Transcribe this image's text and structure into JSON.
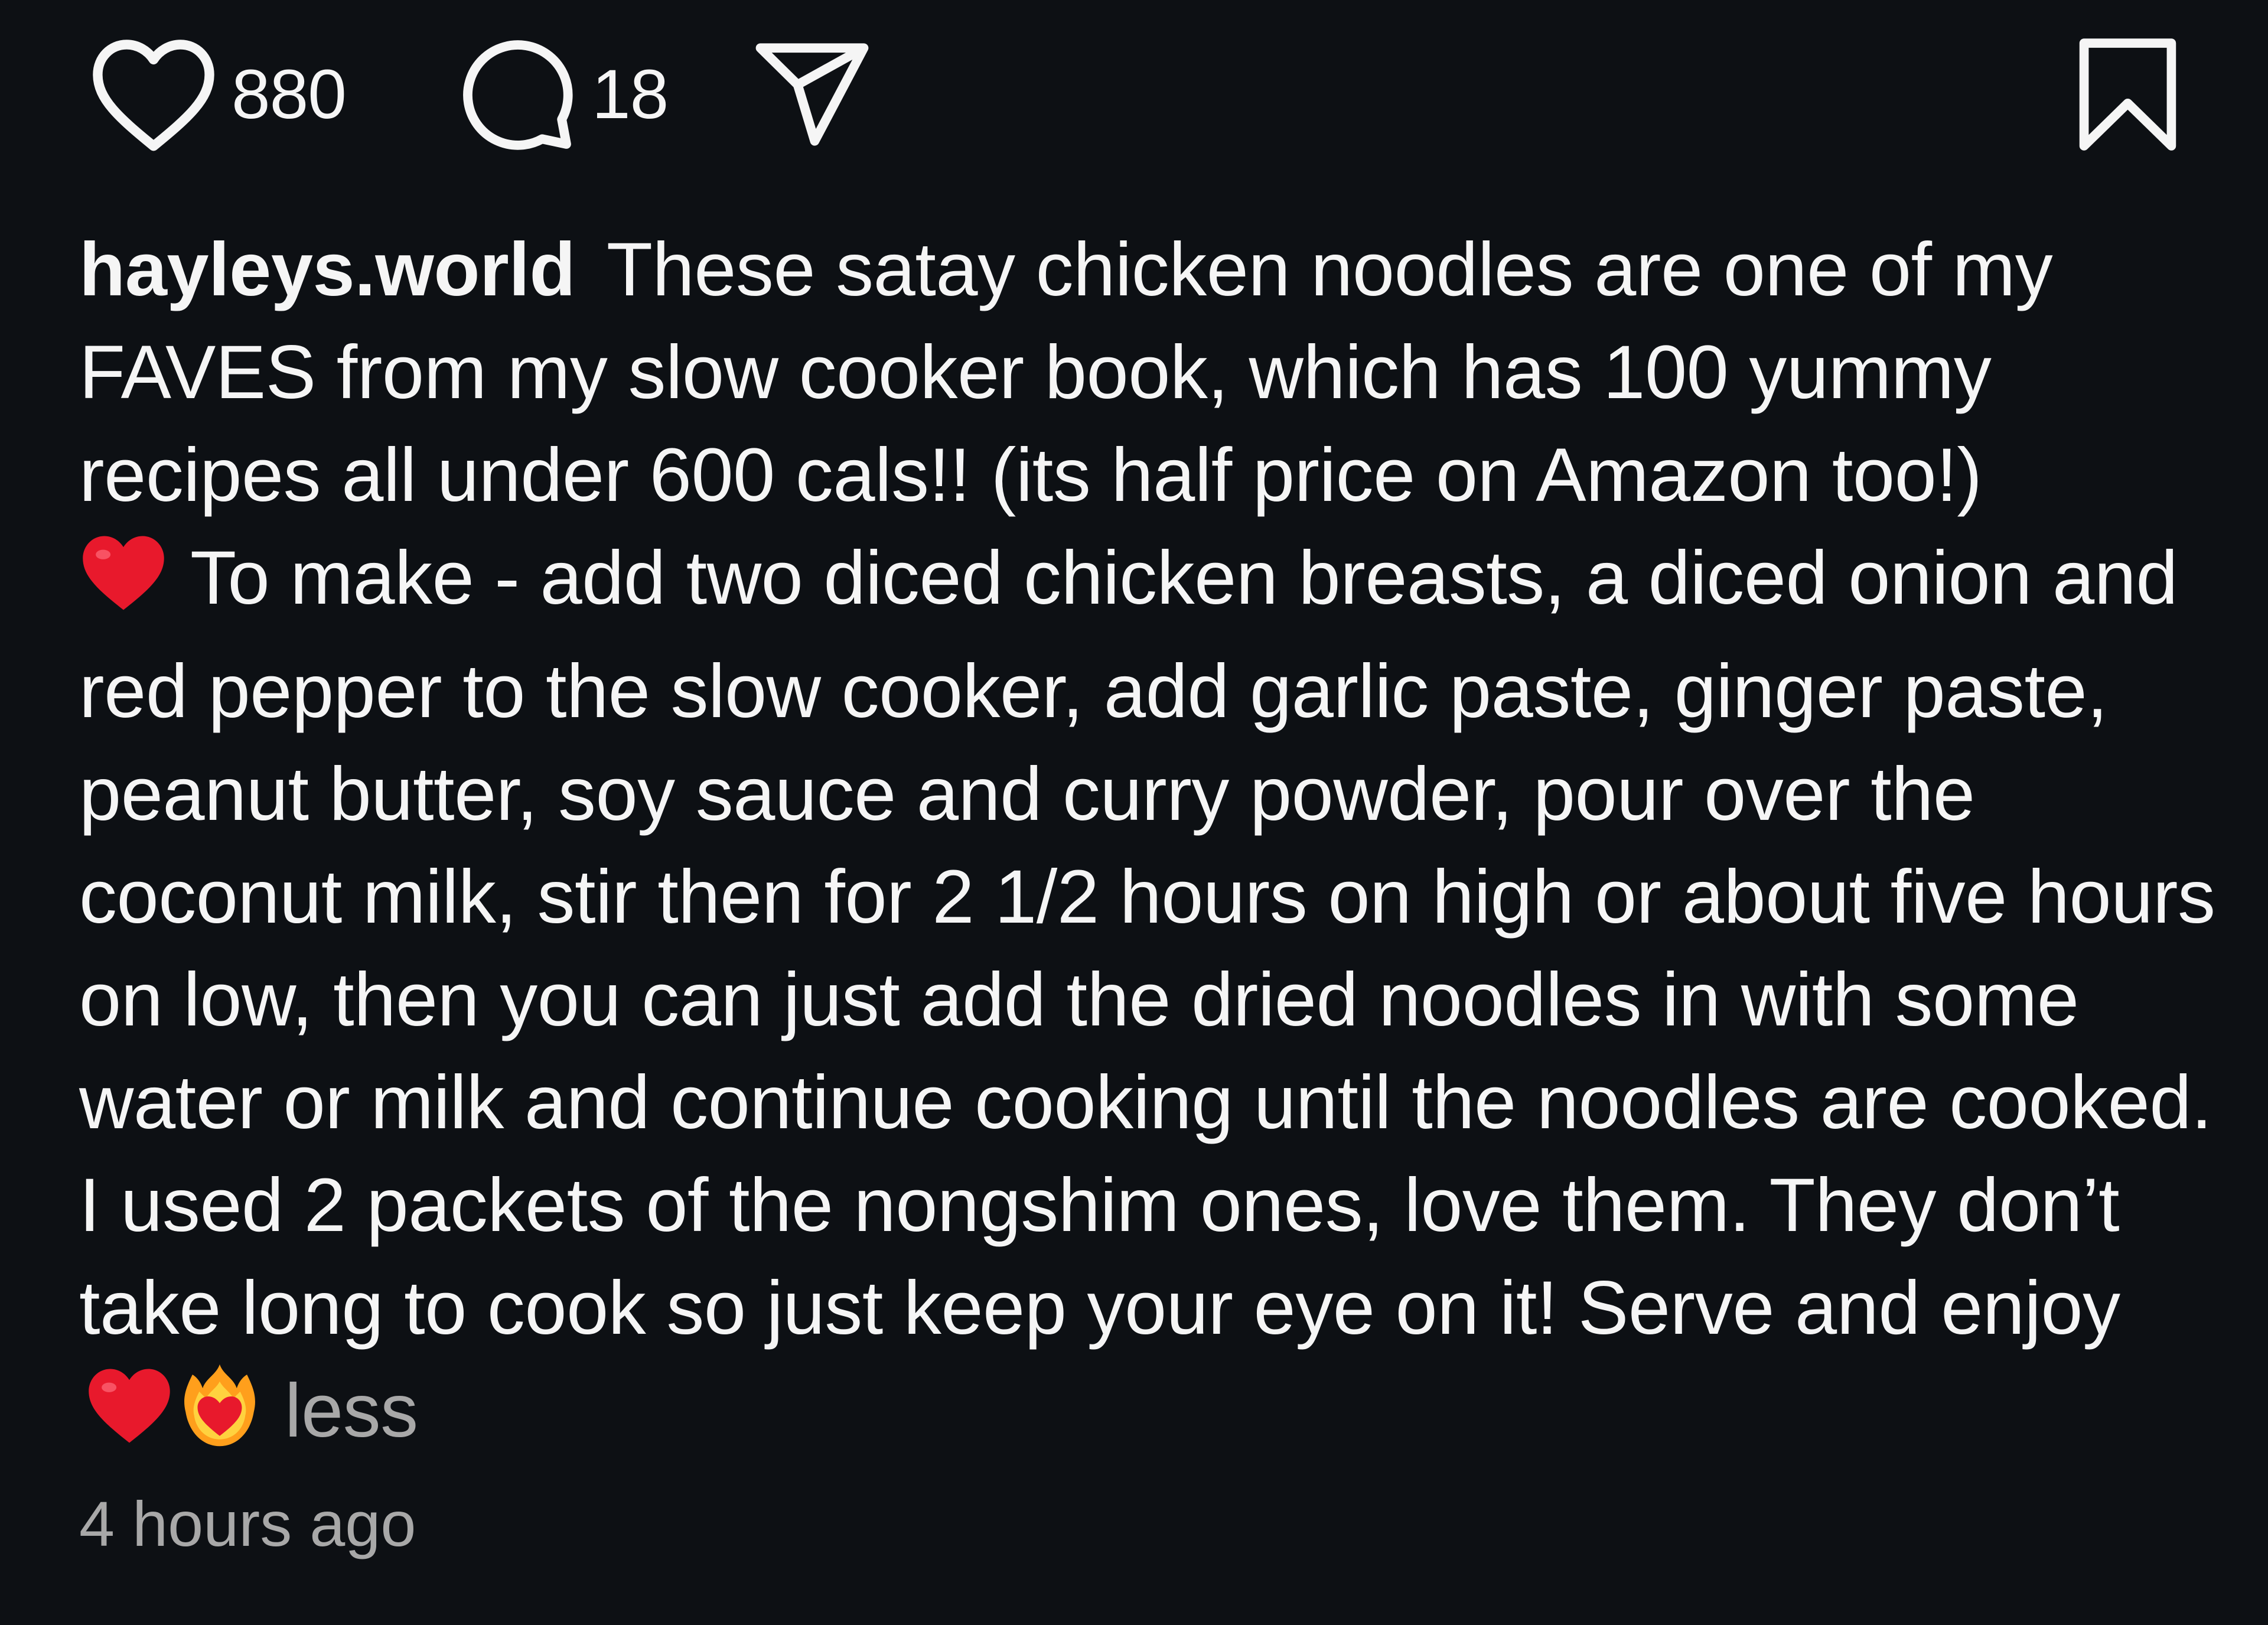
{
  "actions": {
    "like": {
      "icon": "heart-icon",
      "count": "880"
    },
    "comment": {
      "icon": "comment-icon",
      "count": "18"
    },
    "share": {
      "icon": "send-icon"
    },
    "save": {
      "icon": "bookmark-icon"
    }
  },
  "post": {
    "username": "hayleys.world",
    "caption_part1": "These satay chicken noodles are one of my FAVES from my slow cooker book, which has 100 yummy recipes all under 600 cals!! (its half price on Amazon too!)",
    "emoji_heart": "❤️",
    "caption_part2": "To make - add two diced chicken breasts, a diced onion and red pepper to the slow cooker, add garlic paste, ginger paste, peanut butter, soy sauce and curry powder, pour over the coconut milk, stir then for 2 1/2 hours on high or about five hours on low, then you can just add the dried noodles in with some water or milk and continue cooking until the noodles are cooked. I used 2 packets of the nongshim ones, love them. They don’t take long to cook so just keep your eye on it! Serve and enjoy",
    "emoji_fire_heart": "❤️‍🔥",
    "less_label": "less",
    "timestamp": "4 hours ago"
  },
  "colors": {
    "background": "#0d1014",
    "text": "#f5f5f5",
    "muted": "#a8a8a8",
    "heart_emoji": "#e8192c"
  }
}
